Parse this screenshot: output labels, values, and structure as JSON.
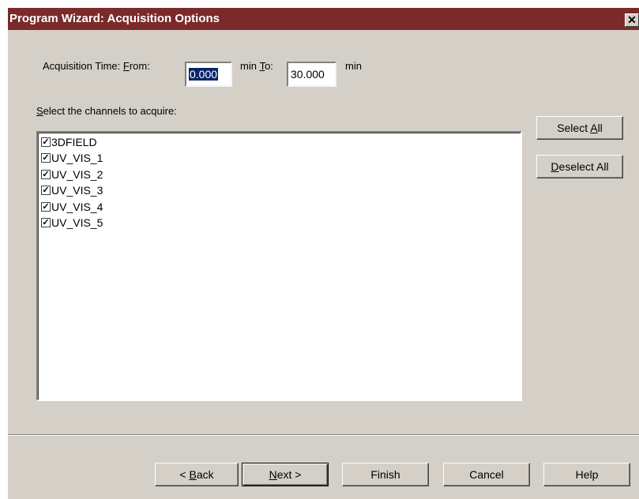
{
  "window": {
    "title": "Program Wizard: Acquisition Options",
    "close_glyph": "✕"
  },
  "acquisition_time": {
    "label_prefix": "Acquisition Time: ",
    "from_mnemonic": "F",
    "from_rest": "rom:",
    "from_value": "0.000",
    "min_label_1": "min",
    "to_mnemonic": "T",
    "to_rest": "o:",
    "to_value": "30.000",
    "min_label_2": "min"
  },
  "channels": {
    "label_mnemonic": "S",
    "label_rest": "elect the channels to acquire:",
    "items": [
      {
        "name": "3DFIELD",
        "checked": true
      },
      {
        "name": "UV_VIS_1",
        "checked": true
      },
      {
        "name": "UV_VIS_2",
        "checked": true
      },
      {
        "name": "UV_VIS_3",
        "checked": true
      },
      {
        "name": "UV_VIS_4",
        "checked": true
      },
      {
        "name": "UV_VIS_5",
        "checked": true
      }
    ],
    "check_glyph": "✓"
  },
  "side_buttons": {
    "select_all_prefix": "Select ",
    "select_all_mnemonic": "A",
    "select_all_rest": "ll",
    "deselect_all_mnemonic": "D",
    "deselect_all_rest": "eselect All"
  },
  "footer": {
    "back_prefix": "< ",
    "back_mnemonic": "B",
    "back_rest": "ack",
    "next_mnemonic": "N",
    "next_rest": "ext >",
    "finish_label": "Finish",
    "cancel_label": "Cancel",
    "help_label": "Help"
  },
  "colors": {
    "titlebar": "#7b2a2a",
    "dialog_face": "#d4d0c8",
    "selection": "#0a246a"
  }
}
